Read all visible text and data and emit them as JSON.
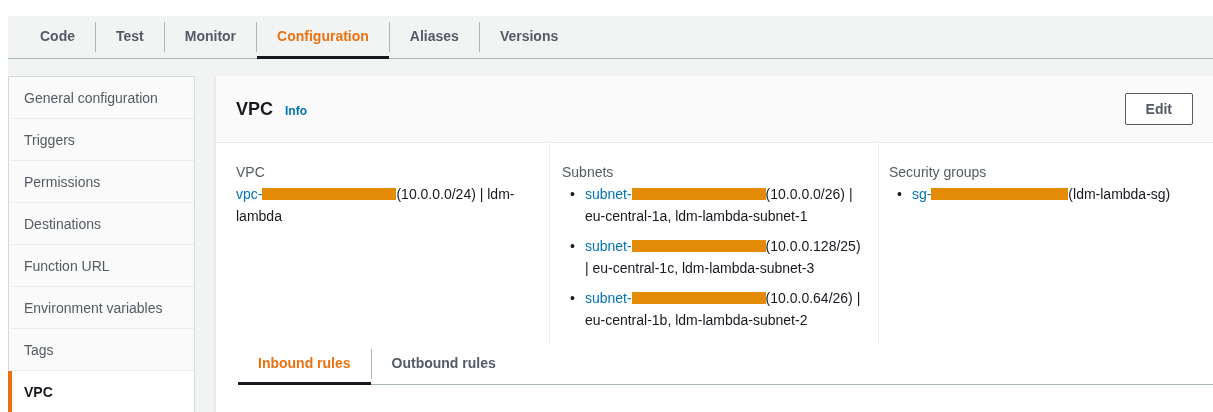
{
  "tabs": [
    {
      "label": "Code",
      "selected": false
    },
    {
      "label": "Test",
      "selected": false
    },
    {
      "label": "Monitor",
      "selected": false
    },
    {
      "label": "Configuration",
      "selected": true
    },
    {
      "label": "Aliases",
      "selected": false
    },
    {
      "label": "Versions",
      "selected": false
    }
  ],
  "sidebar": {
    "items": [
      {
        "label": "General configuration",
        "selected": false
      },
      {
        "label": "Triggers",
        "selected": false
      },
      {
        "label": "Permissions",
        "selected": false
      },
      {
        "label": "Destinations",
        "selected": false
      },
      {
        "label": "Function URL",
        "selected": false
      },
      {
        "label": "Environment variables",
        "selected": false
      },
      {
        "label": "Tags",
        "selected": false
      },
      {
        "label": "VPC",
        "selected": true
      }
    ]
  },
  "panel": {
    "title": "VPC",
    "info": "Info",
    "edit_button": "Edit",
    "vpc": {
      "label": "VPC",
      "link": "vpc-",
      "detail": "(10.0.0.0/24) | ldm-",
      "detail_line_2": "lambda"
    },
    "subnets": {
      "label": "Subnets",
      "items": [
        {
          "bullet": "•",
          "link": "subnet-",
          "detail": "(10.0.0.0/26) |",
          "detail_line_2": "eu-central-1a, ldm-lambda-subnet-1"
        },
        {
          "bullet": "•",
          "link": "subnet-",
          "detail": "(10.0.0.128/25)",
          "detail_line_2": "| eu-central-1c, ldm-lambda-subnet-3"
        },
        {
          "bullet": "•",
          "link": "subnet-",
          "detail": "(10.0.0.64/26) |",
          "detail_line_2": "eu-central-1b, ldm-lambda-subnet-2"
        }
      ]
    },
    "security_groups": {
      "label": "Security groups",
      "items": [
        {
          "bullet": "•",
          "link": "sg-",
          "detail": "(ldm-lambda-sg)"
        }
      ]
    }
  },
  "rules_tabs": [
    {
      "label": "Inbound rules",
      "selected": true
    },
    {
      "label": "Outbound rules",
      "selected": false
    }
  ]
}
